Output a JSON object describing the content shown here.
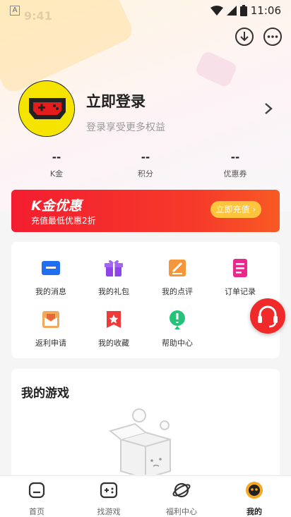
{
  "status_bar": {
    "time": "11:06",
    "time_left": "9:41"
  },
  "profile": {
    "title": "立即登录",
    "subtitle": "登录享受更多权益"
  },
  "stats": [
    {
      "value": "--",
      "label": "K金"
    },
    {
      "value": "--",
      "label": "积分"
    },
    {
      "value": "--",
      "label": "优惠券"
    }
  ],
  "banner": {
    "title": "K金优惠",
    "subtitle": "充值最低优惠2折",
    "button": "立即充值"
  },
  "grid": [
    {
      "label": "我的消息",
      "icon": "message-icon"
    },
    {
      "label": "我的礼包",
      "icon": "gift-icon"
    },
    {
      "label": "我的点评",
      "icon": "review-icon"
    },
    {
      "label": "订单记录",
      "icon": "order-icon"
    },
    {
      "label": "返利申请",
      "icon": "rebate-icon"
    },
    {
      "label": "我的收藏",
      "icon": "favorite-icon"
    },
    {
      "label": "帮助中心",
      "icon": "help-icon"
    }
  ],
  "games": {
    "title": "我的游戏"
  },
  "tabs": [
    {
      "label": "首页",
      "icon": "home-icon"
    },
    {
      "label": "找游戏",
      "icon": "gamepad-icon"
    },
    {
      "label": "福利中心",
      "icon": "planet-icon"
    },
    {
      "label": "我的",
      "icon": "profile-icon",
      "active": true
    }
  ],
  "colors": {
    "accent": "#f31d2f",
    "button_yellow": "#ffc43d"
  }
}
